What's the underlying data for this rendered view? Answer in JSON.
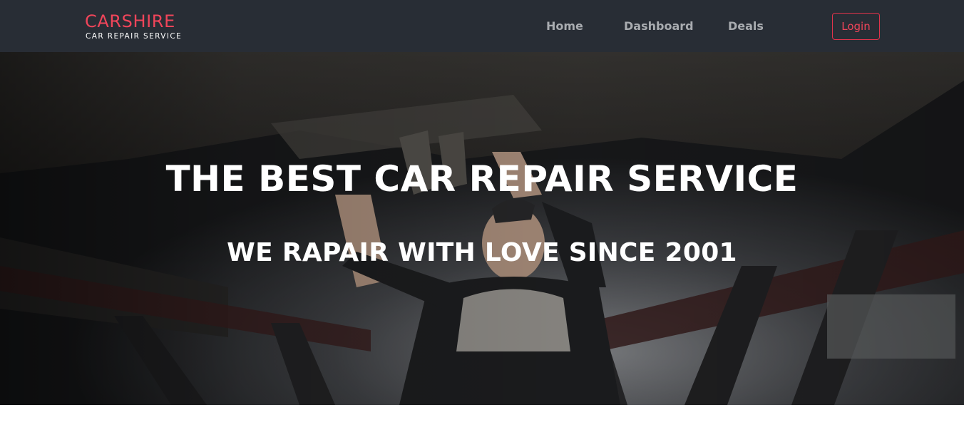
{
  "brand": {
    "name": "CARSHIRE",
    "tagline": "CAR REPAIR SERVICE"
  },
  "nav": {
    "links": [
      {
        "label": "Home"
      },
      {
        "label": "Dashboard"
      },
      {
        "label": "Deals"
      }
    ],
    "login_label": "Login"
  },
  "hero": {
    "title": "THE BEST CAR REPAIR SERVICE",
    "subtitle": "WE RAPAIR WITH LOVE SINCE 2001",
    "image_subject": "mechanic-working-under-lifted-car"
  },
  "colors": {
    "navbar_bg": "#282d35",
    "brand_accent": "#f0455a",
    "nav_link": "#a9acb0",
    "hero_text": "#ffffff"
  }
}
